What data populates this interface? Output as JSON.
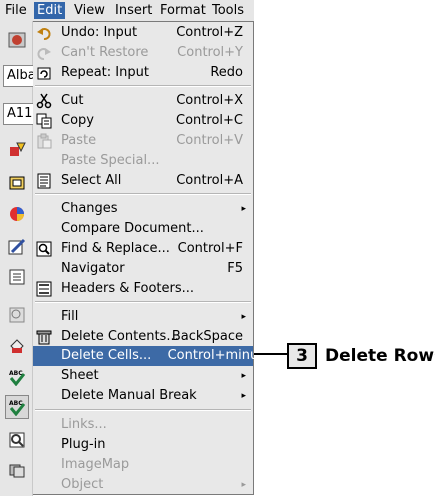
{
  "menubar": {
    "items": [
      "File",
      "Edit",
      "View",
      "Insert",
      "Format",
      "Tools"
    ],
    "active": "Edit"
  },
  "left_toolbar": {
    "font_name_field": "Alba",
    "font_size_field": "A11"
  },
  "edit_menu": {
    "items": [
      {
        "label": "Undo: Input",
        "shortcut": "Control+Z",
        "icon": "undo-icon",
        "enabled": true
      },
      {
        "label": "Can't Restore",
        "shortcut": "Control+Y",
        "icon": "redo-icon",
        "enabled": false
      },
      {
        "label": "Repeat: Input",
        "shortcut": "Redo",
        "icon": "repeat-icon",
        "enabled": true
      },
      {
        "label": "Cut",
        "shortcut": "Control+X",
        "icon": "scissors-icon",
        "enabled": true
      },
      {
        "label": "Copy",
        "shortcut": "Control+C",
        "icon": "copy-icon",
        "enabled": true
      },
      {
        "label": "Paste",
        "shortcut": "Control+V",
        "icon": "paste-icon",
        "enabled": false
      },
      {
        "label": "Paste Special...",
        "shortcut": "",
        "icon": "",
        "enabled": false
      },
      {
        "label": "Select All",
        "shortcut": "Control+A",
        "icon": "select-all-icon",
        "enabled": true
      },
      {
        "label": "Changes",
        "shortcut": "",
        "icon": "",
        "enabled": true,
        "submenu": true
      },
      {
        "label": "Compare Document...",
        "shortcut": "",
        "icon": "",
        "enabled": true
      },
      {
        "label": "Find & Replace...",
        "shortcut": "Control+F",
        "icon": "find-replace-icon",
        "enabled": true
      },
      {
        "label": "Navigator",
        "shortcut": "F5",
        "icon": "",
        "enabled": true
      },
      {
        "label": "Headers & Footers...",
        "shortcut": "",
        "icon": "headers-footers-icon",
        "enabled": true
      },
      {
        "label": "Fill",
        "shortcut": "",
        "icon": "",
        "enabled": true,
        "submenu": true
      },
      {
        "label": "Delete Contents...",
        "shortcut": "BackSpace",
        "icon": "trash-icon",
        "enabled": true
      },
      {
        "label": "Delete Cells...",
        "shortcut": "Control+minus",
        "icon": "",
        "enabled": true,
        "highlighted": true
      },
      {
        "label": "Sheet",
        "shortcut": "",
        "icon": "",
        "enabled": true,
        "submenu": true
      },
      {
        "label": "Delete Manual Break",
        "shortcut": "",
        "icon": "",
        "enabled": true,
        "submenu": true
      },
      {
        "label": "Links...",
        "shortcut": "",
        "icon": "",
        "enabled": false
      },
      {
        "label": "Plug-in",
        "shortcut": "",
        "icon": "",
        "enabled": true
      },
      {
        "label": "ImageMap",
        "shortcut": "",
        "icon": "",
        "enabled": false
      },
      {
        "label": "Object",
        "shortcut": "",
        "icon": "",
        "enabled": false,
        "submenu": true
      }
    ]
  },
  "callout": {
    "number": "3",
    "text": "Delete Rows"
  },
  "colors": {
    "highlight": "#3d6aa6",
    "menu_bg": "#e8e8e8",
    "disabled_text": "#9a9a9a"
  }
}
